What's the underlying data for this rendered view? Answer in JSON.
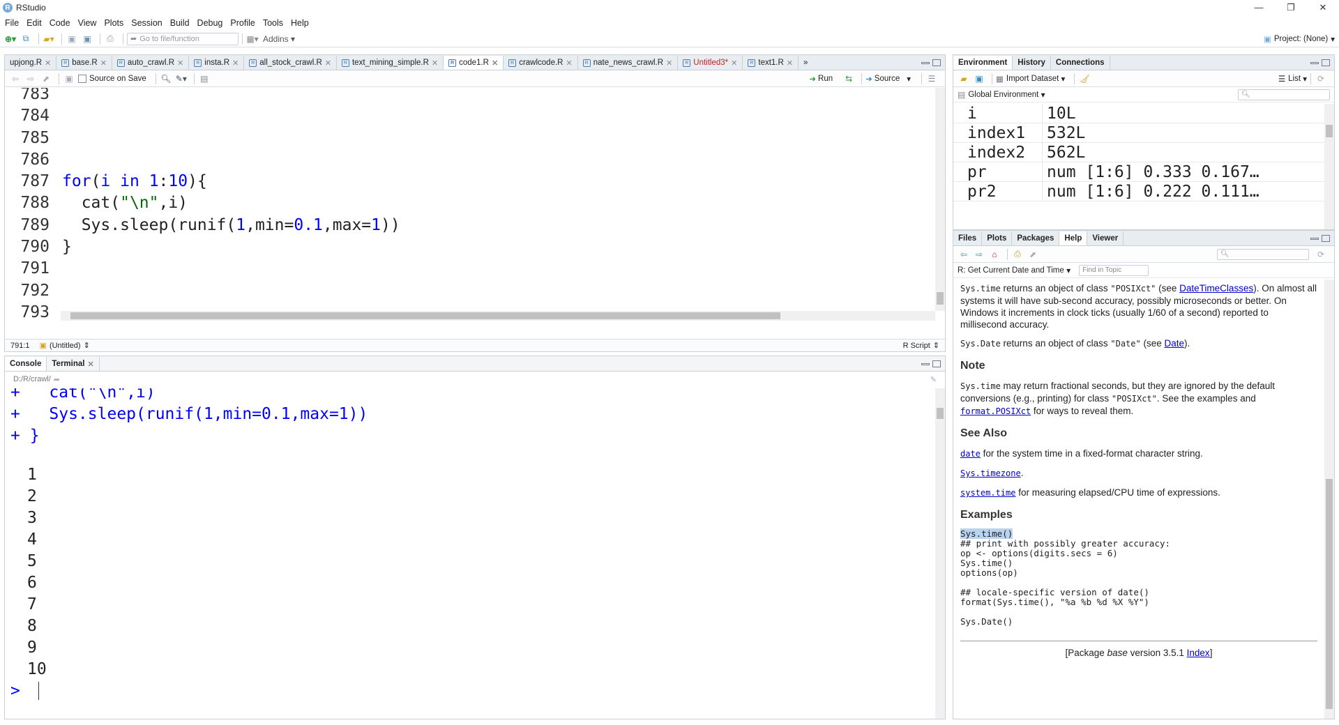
{
  "app": {
    "title": "RStudio",
    "logo": "R"
  },
  "window_controls": {
    "minimize": "—",
    "maximize": "❐",
    "close": "✕"
  },
  "menu": [
    "File",
    "Edit",
    "Code",
    "View",
    "Plots",
    "Session",
    "Build",
    "Debug",
    "Profile",
    "Tools",
    "Help"
  ],
  "toolbar": {
    "goto_placeholder": "Go to file/function",
    "addins": "Addins",
    "project": "Project: (None)"
  },
  "editor": {
    "tabs": [
      "upjong.R",
      "base.R",
      "auto_crawl.R",
      "insta.R",
      "all_stock_crawl.R",
      "text_mining_simple.R",
      "code1.R",
      "crawlcode.R",
      "nate_news_crawl.R",
      "Untitled3*",
      "text1.R"
    ],
    "active_tab": "code1.R",
    "source_on_save": "Source on Save",
    "run": "Run",
    "source": "Source",
    "line_numbers": [
      "783",
      "784",
      "785",
      "786",
      "787",
      "788",
      "789",
      "790",
      "791",
      "792",
      "793"
    ],
    "status_pos": "791:1",
    "status_scope": "(Untitled)",
    "status_type": "R Script"
  },
  "console": {
    "tabs": [
      "Console",
      "Terminal"
    ],
    "path": "D:/R/crawl/",
    "echo": [
      "+   cat(\"\\n\",i)",
      "+   Sys.sleep(runif(1,min=0.1,max=1))",
      "+ }"
    ],
    "output": [
      "1",
      "2",
      "3",
      "4",
      "5",
      "6",
      "7",
      "8",
      "9",
      "10"
    ],
    "prompt": ">"
  },
  "env": {
    "tabs": [
      "Environment",
      "History",
      "Connections"
    ],
    "import_dataset": "Import Dataset",
    "list": "List",
    "scope": "Global Environment",
    "rows": [
      {
        "name": "i",
        "value": "10L"
      },
      {
        "name": "index1",
        "value": "532L"
      },
      {
        "name": "index2",
        "value": "562L"
      },
      {
        "name": "pr",
        "value": "num [1:6] 0.333 0.167…"
      },
      {
        "name": "pr2",
        "value": "num [1:6] 0.222 0.111…"
      }
    ]
  },
  "help": {
    "tabs": [
      "Files",
      "Plots",
      "Packages",
      "Help",
      "Viewer"
    ],
    "topic": "R: Get Current Date and Time",
    "find_placeholder": "Find in Topic",
    "p1_code": "Sys.time",
    "p1_a": " returns an object of class ",
    "p1_cls": "\"POSIXct\"",
    "p1_b": " (see ",
    "p1_link": "DateTimeClasses",
    "p1_c": "). On almost all systems it will have sub-second accuracy, possibly microseconds or better. On Windows it increments in clock ticks (usually 1/60 of a second) reported to millisecond accuracy.",
    "p2_code": "Sys.Date",
    "p2_a": " returns an object of class ",
    "p2_cls": "\"Date\"",
    "p2_b": " (see ",
    "p2_link": "Date",
    "p2_c": ").",
    "note_h": "Note",
    "note_code": "Sys.time",
    "note_a": " may return fractional seconds, but they are ignored by the default conversions (e.g., printing) for class ",
    "note_cls": "\"POSIXct\"",
    "note_b": ". See the examples and ",
    "note_link": "format.POSIXct",
    "note_c": " for ways to reveal them.",
    "see_h": "See Also",
    "see1_link": "date",
    "see1_text": " for the system time in a fixed-format character string.",
    "see2_link": "Sys.timezone",
    "see2_text": ".",
    "see3_link": "system.time",
    "see3_text": " for measuring elapsed/CPU time of expressions.",
    "examples_h": "Examples",
    "ex_first": "Sys.time()",
    "ex_rest": "## print with possibly greater accuracy:\nop <- options(digits.secs = 6)\nSys.time()\noptions(op)\n\n## locale-specific version of date()\nformat(Sys.time(), \"%a %b %d %X %Y\")\n\nSys.Date()",
    "footer_a": "[Package ",
    "footer_pkg": "base",
    "footer_b": " version 3.5.1 ",
    "footer_link": "Index",
    "footer_c": "]"
  },
  "colors": {
    "keyword": "#0000ff",
    "string": "#036a07",
    "accent": "#75aadb"
  }
}
